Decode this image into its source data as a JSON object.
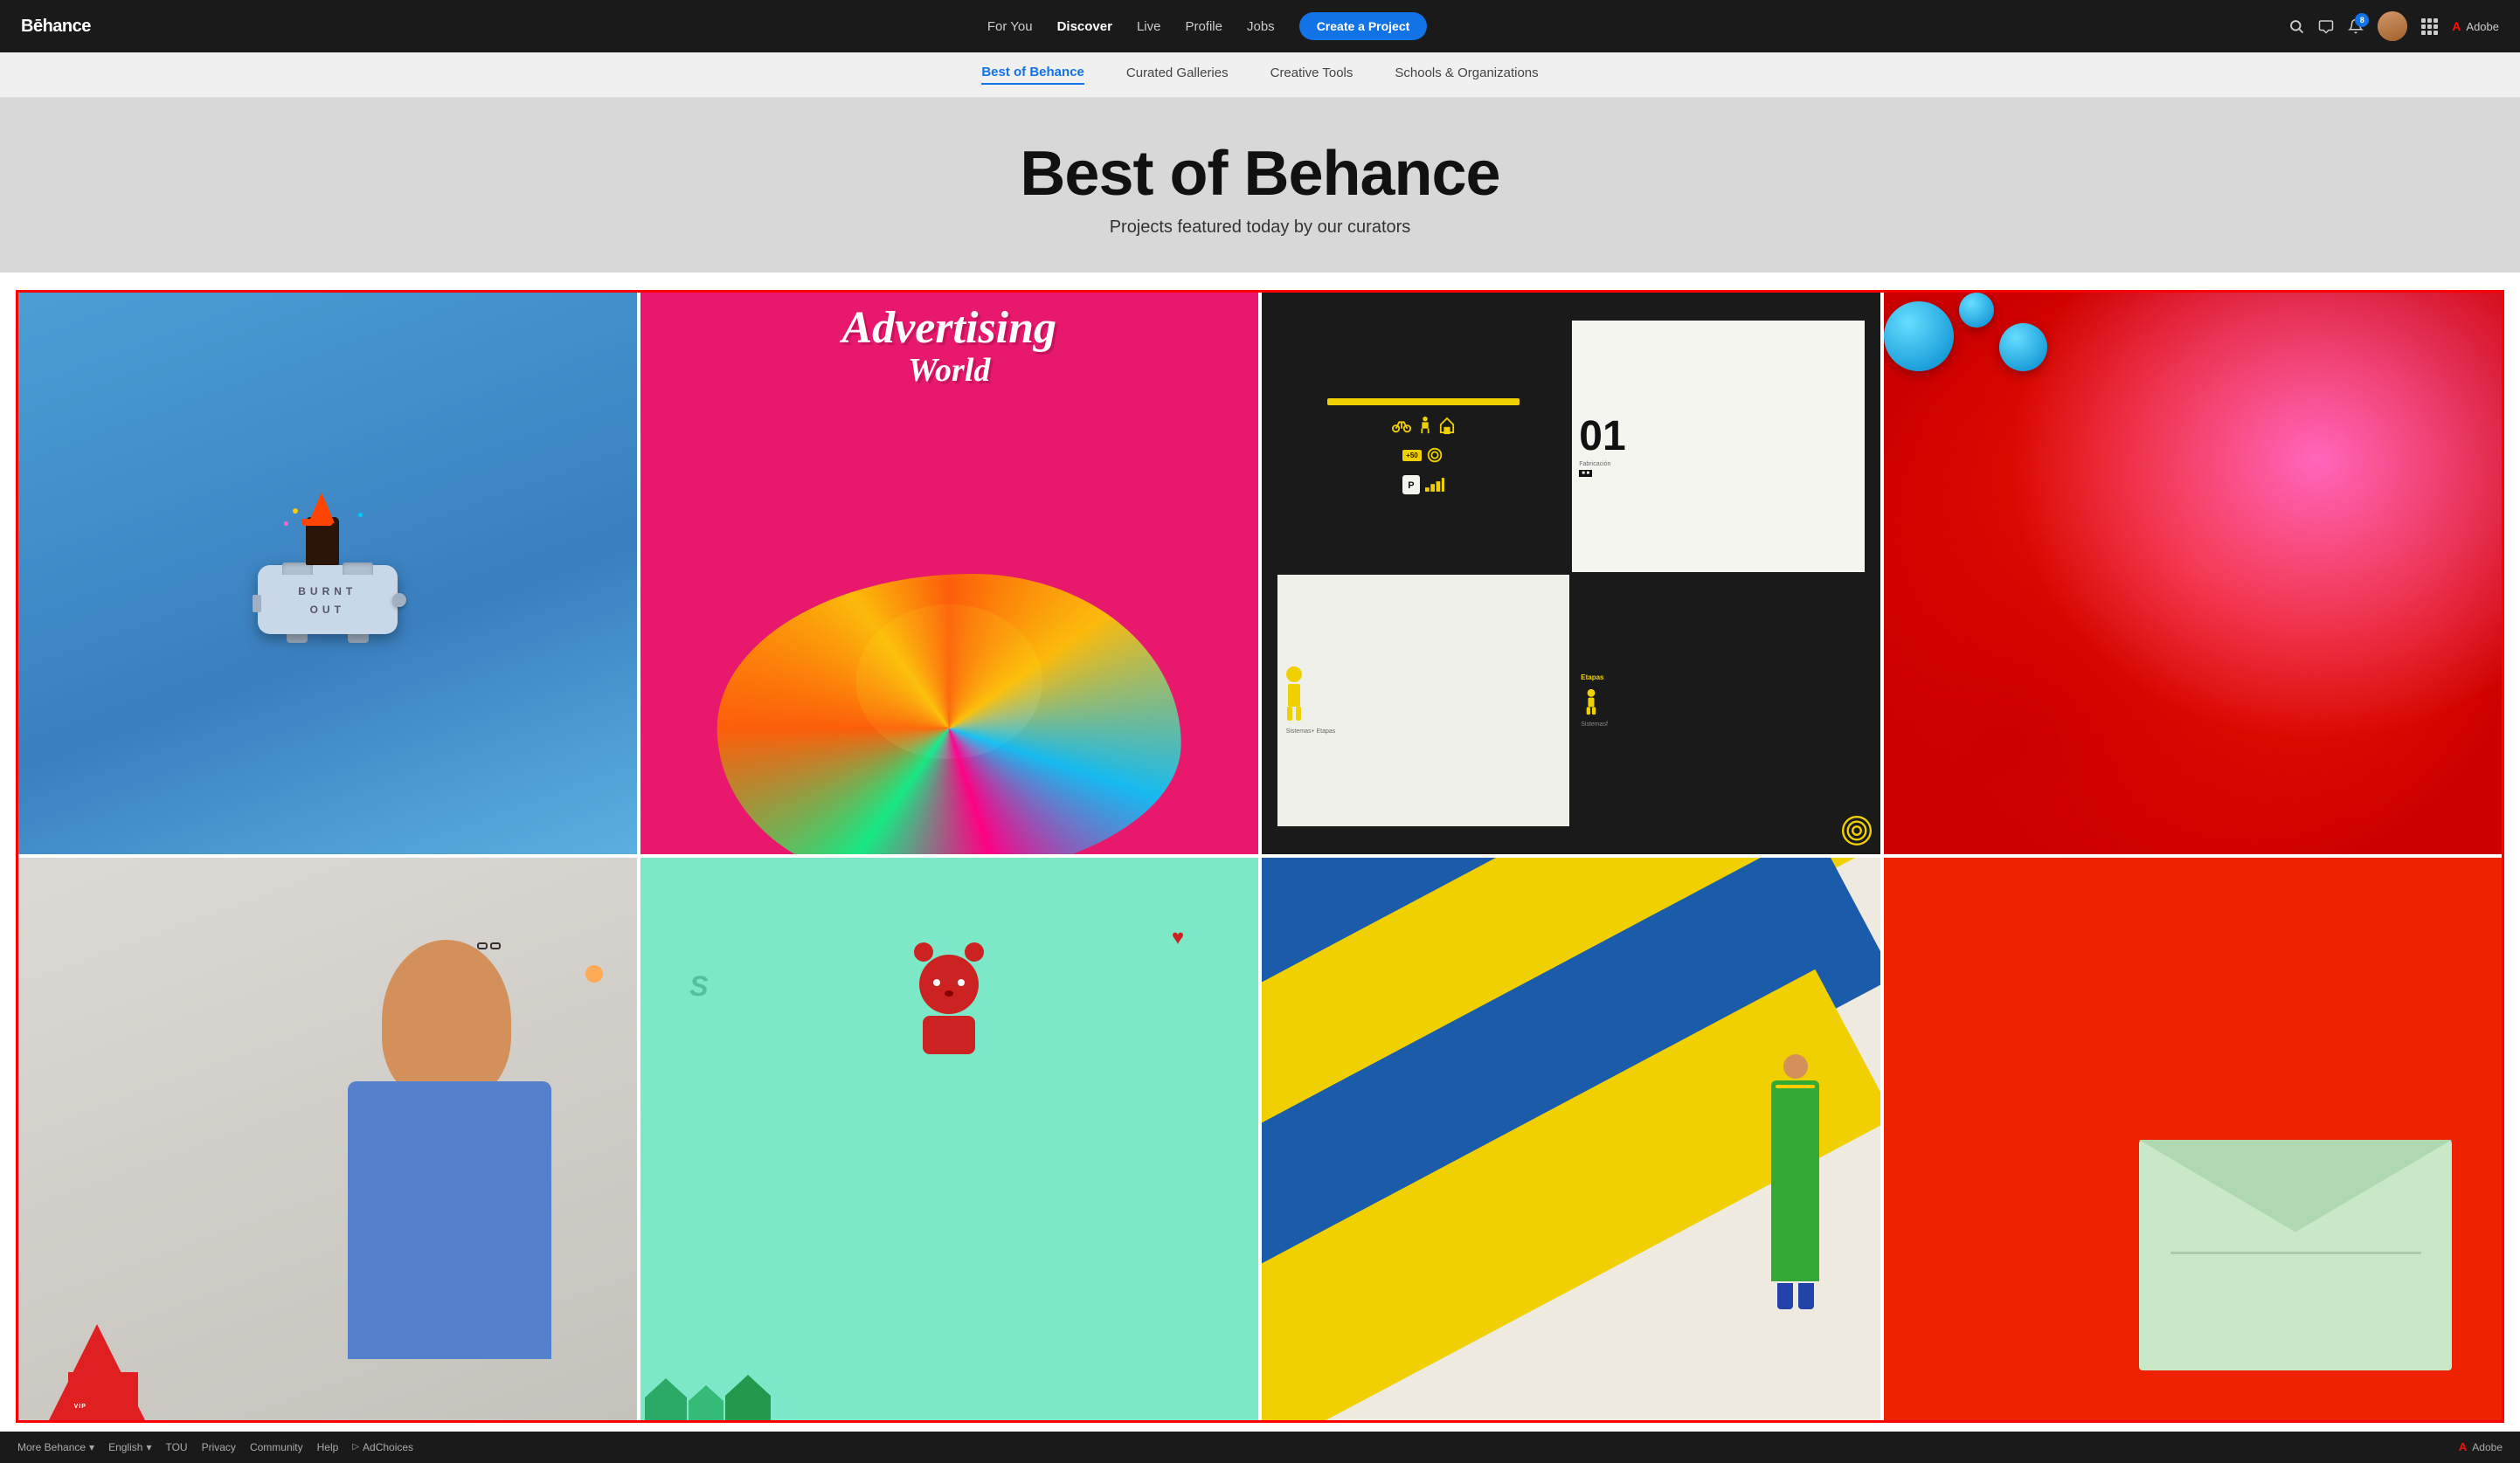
{
  "navbar": {
    "logo": "Bēhance",
    "nav_items": [
      {
        "label": "For You",
        "active": false
      },
      {
        "label": "Discover",
        "active": true
      },
      {
        "label": "Live",
        "active": false
      },
      {
        "label": "Profile",
        "active": false
      },
      {
        "label": "Jobs",
        "active": false
      }
    ],
    "create_button": "Create a Project",
    "notification_count": "8",
    "adobe_label": "Adobe"
  },
  "subnav": {
    "items": [
      {
        "label": "Best of Behance",
        "active": true
      },
      {
        "label": "Curated Galleries",
        "active": false
      },
      {
        "label": "Creative Tools",
        "active": false
      },
      {
        "label": "Schools & Organizations",
        "active": false
      }
    ]
  },
  "hero": {
    "title": "Best of Behance",
    "subtitle": "Projects featured today by our curators"
  },
  "gallery": {
    "row1": [
      {
        "id": "card-1",
        "type": "toaster",
        "alt": "Burnt Out toaster project"
      },
      {
        "id": "card-2",
        "type": "advertising",
        "alt": "Advertising World illustration"
      },
      {
        "id": "card-3",
        "type": "design-system",
        "alt": "Design system project"
      },
      {
        "id": "card-4",
        "type": "circles",
        "alt": "Red background with blue circles"
      }
    ],
    "row2": [
      {
        "id": "card-5",
        "type": "person",
        "alt": "VIP person photo project"
      },
      {
        "id": "card-6",
        "type": "bear",
        "alt": "Red bear illustration"
      },
      {
        "id": "card-7",
        "type": "stripes",
        "alt": "Yellow blue stripes with worker"
      },
      {
        "id": "card-8",
        "type": "envelope",
        "alt": "Red background envelope"
      }
    ]
  },
  "footer": {
    "more_behance": "More Behance",
    "english": "English",
    "links": [
      "TOU",
      "Privacy",
      "Community",
      "Help"
    ],
    "adchoices": "AdChoices",
    "adobe_label": "Adobe"
  }
}
